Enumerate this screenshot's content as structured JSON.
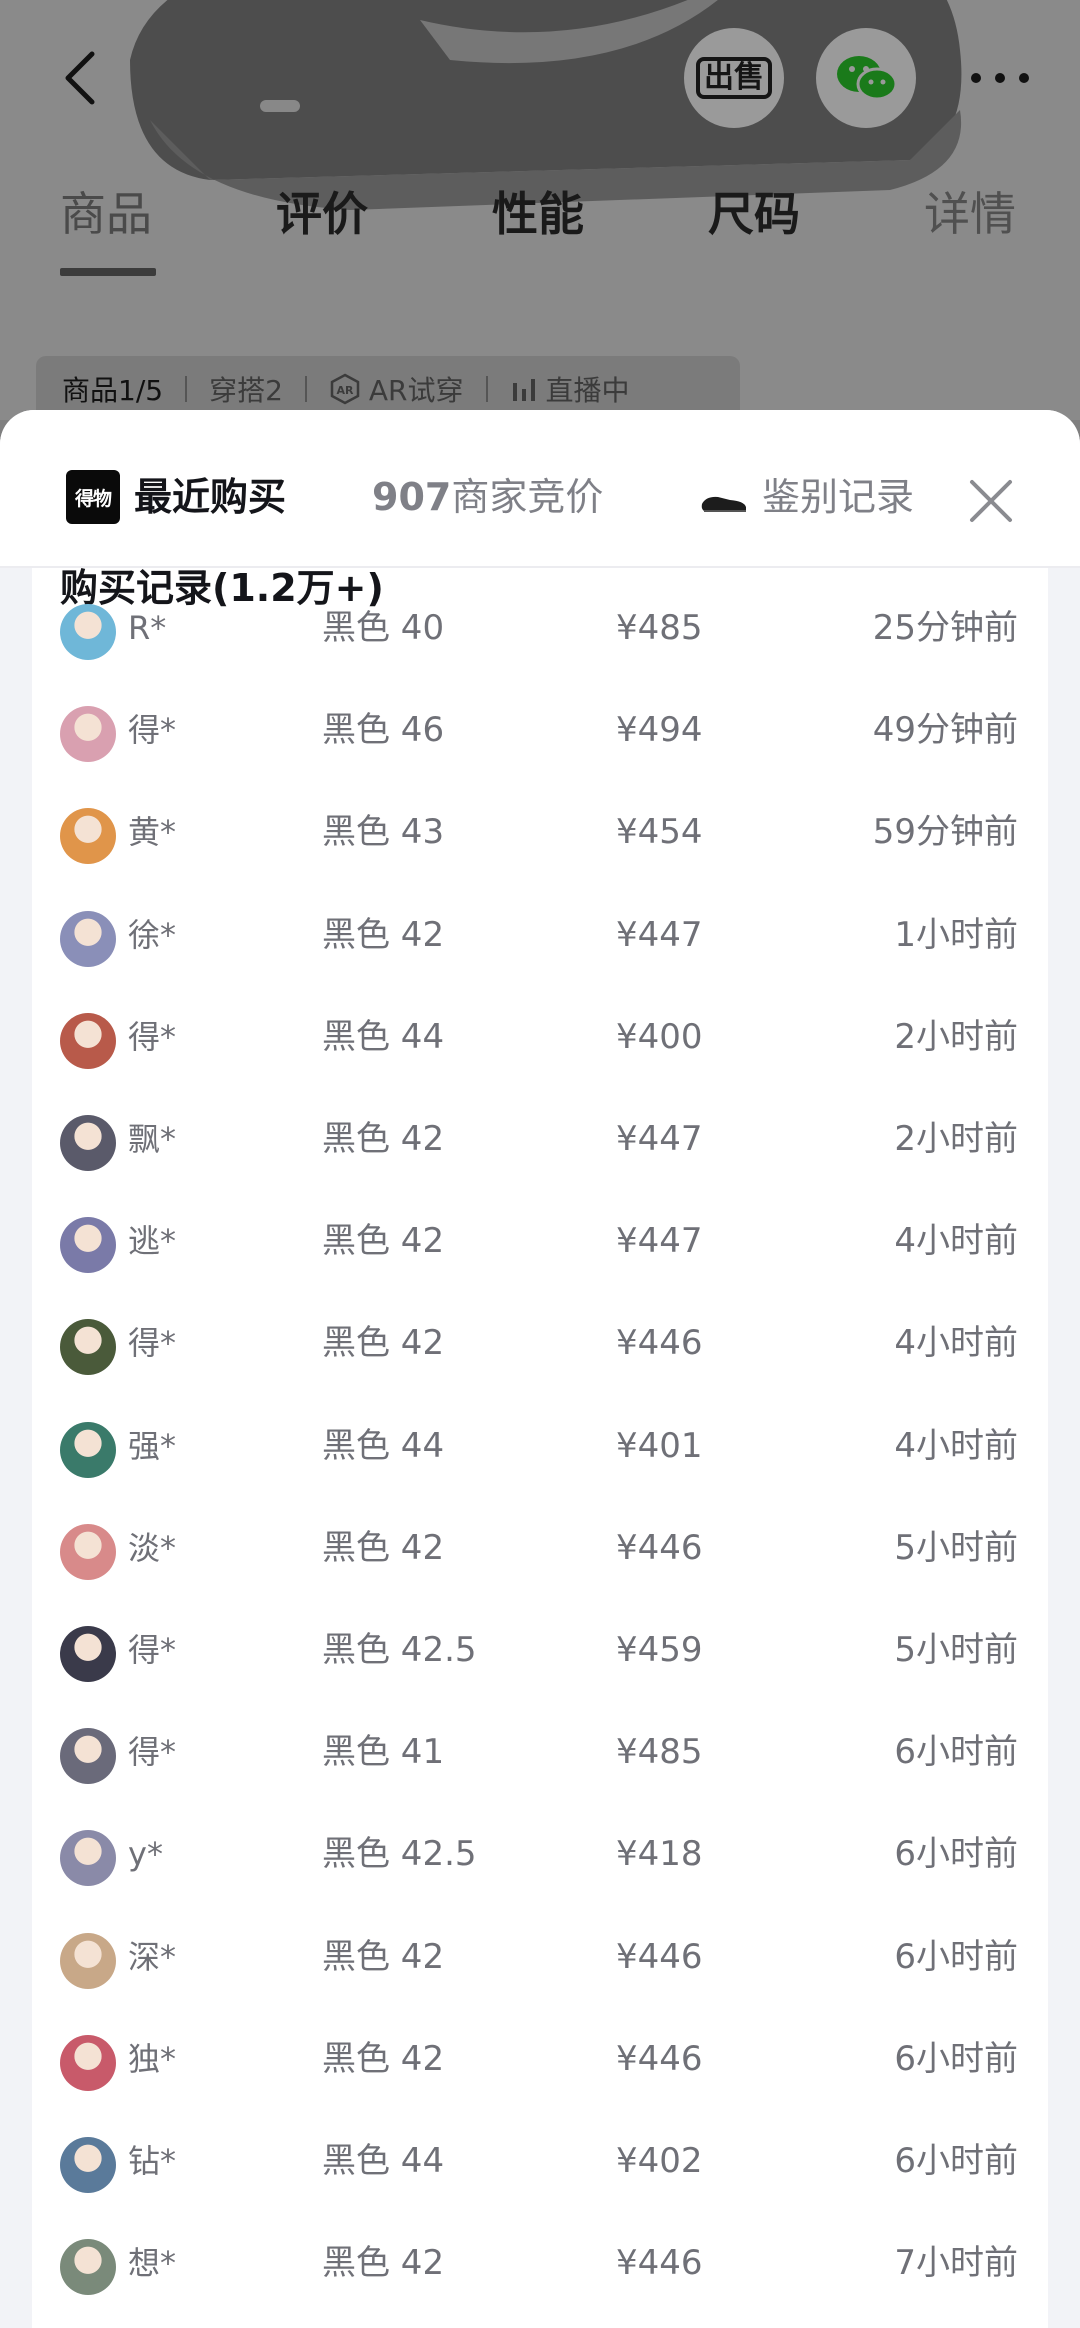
{
  "product_page": {
    "tabs": [
      {
        "label": "商品"
      },
      {
        "label": "评价"
      },
      {
        "label": "性能"
      },
      {
        "label": "尺码"
      },
      {
        "label": "详情"
      }
    ],
    "sell_label": "出售",
    "chips": [
      "商品1/5",
      "穿搭2",
      "AR试穿",
      "直播中"
    ]
  },
  "sheet": {
    "logo_text": "得物",
    "tabs": {
      "recent": "最近购买",
      "bidding_count": "907",
      "bidding_label": "商家竞价",
      "auth": "鉴别记录"
    },
    "section_title": "购买记录(1.2万+)",
    "records": [
      {
        "user": "R*",
        "spec": "黑色 40",
        "price": "¥485",
        "time": "25分钟前",
        "avatar_color": "#6fb7d8"
      },
      {
        "user": "得*",
        "spec": "黑色 46",
        "price": "¥494",
        "time": "49分钟前",
        "avatar_color": "#d9a0b0"
      },
      {
        "user": "黄*",
        "spec": "黑色 43",
        "price": "¥454",
        "time": "59分钟前",
        "avatar_color": "#e0954a"
      },
      {
        "user": "徐*",
        "spec": "黑色 42",
        "price": "¥447",
        "time": "1小时前",
        "avatar_color": "#8a8fb8"
      },
      {
        "user": "得*",
        "spec": "黑色 44",
        "price": "¥400",
        "time": "2小时前",
        "avatar_color": "#b85a4a"
      },
      {
        "user": "飘*",
        "spec": "黑色 42",
        "price": "¥447",
        "time": "2小时前",
        "avatar_color": "#5a5a6a"
      },
      {
        "user": "逃*",
        "spec": "黑色 42",
        "price": "¥447",
        "time": "4小时前",
        "avatar_color": "#7a7aa8"
      },
      {
        "user": "得*",
        "spec": "黑色 42",
        "price": "¥446",
        "time": "4小时前",
        "avatar_color": "#4a5a3a"
      },
      {
        "user": "强*",
        "spec": "黑色 44",
        "price": "¥401",
        "time": "4小时前",
        "avatar_color": "#3a7a6a"
      },
      {
        "user": "淡*",
        "spec": "黑色 42",
        "price": "¥446",
        "time": "5小时前",
        "avatar_color": "#d88a8a"
      },
      {
        "user": "得*",
        "spec": "黑色 42.5",
        "price": "¥459",
        "time": "5小时前",
        "avatar_color": "#3a3a4a"
      },
      {
        "user": "得*",
        "spec": "黑色 41",
        "price": "¥485",
        "time": "6小时前",
        "avatar_color": "#6a6a7a"
      },
      {
        "user": "y*",
        "spec": "黑色 42.5",
        "price": "¥418",
        "time": "6小时前",
        "avatar_color": "#8a8aa8"
      },
      {
        "user": "深*",
        "spec": "黑色 42",
        "price": "¥446",
        "time": "6小时前",
        "avatar_color": "#c8a888"
      },
      {
        "user": "独*",
        "spec": "黑色 42",
        "price": "¥446",
        "time": "6小时前",
        "avatar_color": "#c85a6a"
      },
      {
        "user": "钻*",
        "spec": "黑色 44",
        "price": "¥402",
        "time": "6小时前",
        "avatar_color": "#5a7a9a"
      },
      {
        "user": "想*",
        "spec": "黑色 42",
        "price": "¥446",
        "time": "7小时前",
        "avatar_color": "#7a8a7a"
      }
    ]
  }
}
